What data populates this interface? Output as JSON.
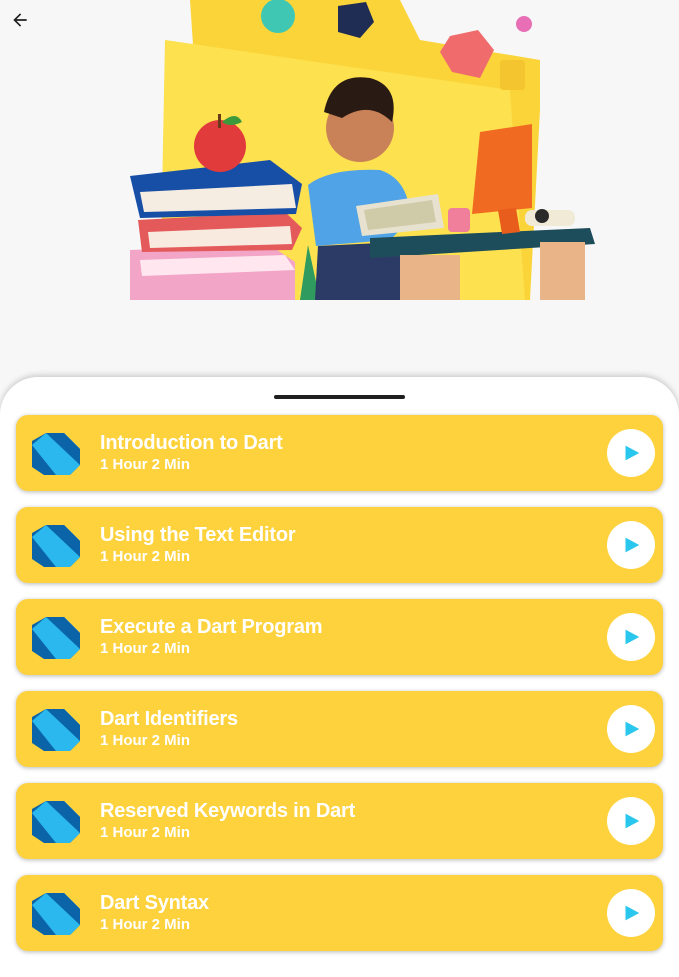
{
  "header": {
    "back_icon": "arrow-left-icon",
    "hero_image": "student-at-desk-illustration"
  },
  "colors": {
    "card_background": "#fdd23d",
    "text": "#ffffff",
    "play_icon": "#29c6ee",
    "dart_dark": "#0b64a8",
    "dart_light": "#2ab8ef"
  },
  "lessons": [
    {
      "title": "Introduction to Dart",
      "duration": "1 Hour 2 Min",
      "icon": "dart-logo-icon",
      "action_icon": "play-icon"
    },
    {
      "title": "Using the Text Editor",
      "duration": "1 Hour 2 Min",
      "icon": "dart-logo-icon",
      "action_icon": "play-icon"
    },
    {
      "title": "Execute a Dart Program",
      "duration": "1 Hour 2 Min",
      "icon": "dart-logo-icon",
      "action_icon": "play-icon"
    },
    {
      "title": "Dart Identifiers",
      "duration": "1 Hour 2 Min",
      "icon": "dart-logo-icon",
      "action_icon": "play-icon"
    },
    {
      "title": "Reserved Keywords in Dart",
      "duration": "1 Hour 2 Min",
      "icon": "dart-logo-icon",
      "action_icon": "play-icon"
    },
    {
      "title": "Dart Syntax",
      "duration": "1 Hour 2 Min",
      "icon": "dart-logo-icon",
      "action_icon": "play-icon"
    }
  ]
}
